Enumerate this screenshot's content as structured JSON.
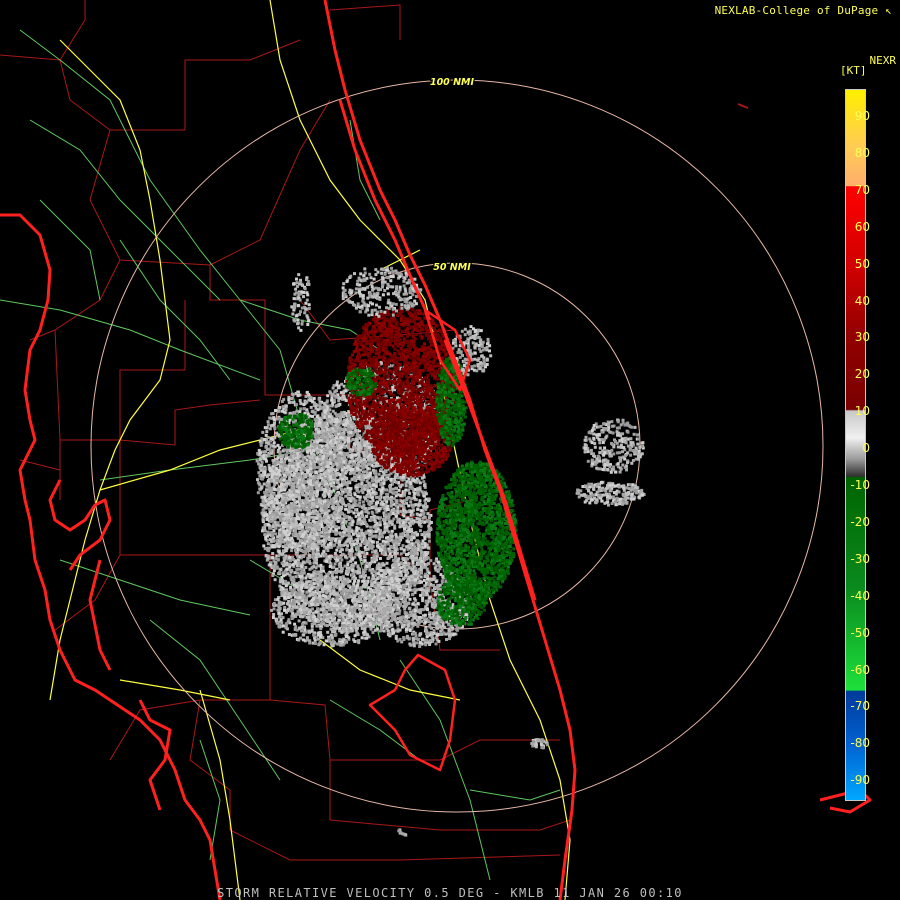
{
  "header": {
    "credit": "NEXLAB-College of DuPage ↖"
  },
  "legend": {
    "title": "NEXR",
    "unit": "[KT]",
    "ticks": [
      "90",
      "80",
      "70",
      "60",
      "50",
      "40",
      "30",
      "20",
      "10",
      "0",
      "-10",
      "-20",
      "-30",
      "-40",
      "-50",
      "-60",
      "-70",
      "-80",
      "-90"
    ],
    "colors": {
      "high_yellow": "#ffee00",
      "orange": "#ffb06a",
      "red": "#ff0000",
      "dark_red": "#7a0000",
      "gray": "#9a9a9a",
      "dark_green": "#006400",
      "bright_green": "#1ee03c",
      "dark_blue": "#003a9a",
      "light_blue": "#00a8ff"
    }
  },
  "map": {
    "range_rings": [
      {
        "label": "100 NMI"
      },
      {
        "label": "50 NMI"
      }
    ],
    "colors": {
      "coastline": "#ff2020",
      "county_lines": "#a81818",
      "highways": "#ffff40",
      "roads": "#6ad06a",
      "range_ring": "#e8b8a8"
    }
  },
  "caption": "STORM RELATIVE VELOCITY 0.5 DEG - KMLB 11 JAN 26 00:10"
}
